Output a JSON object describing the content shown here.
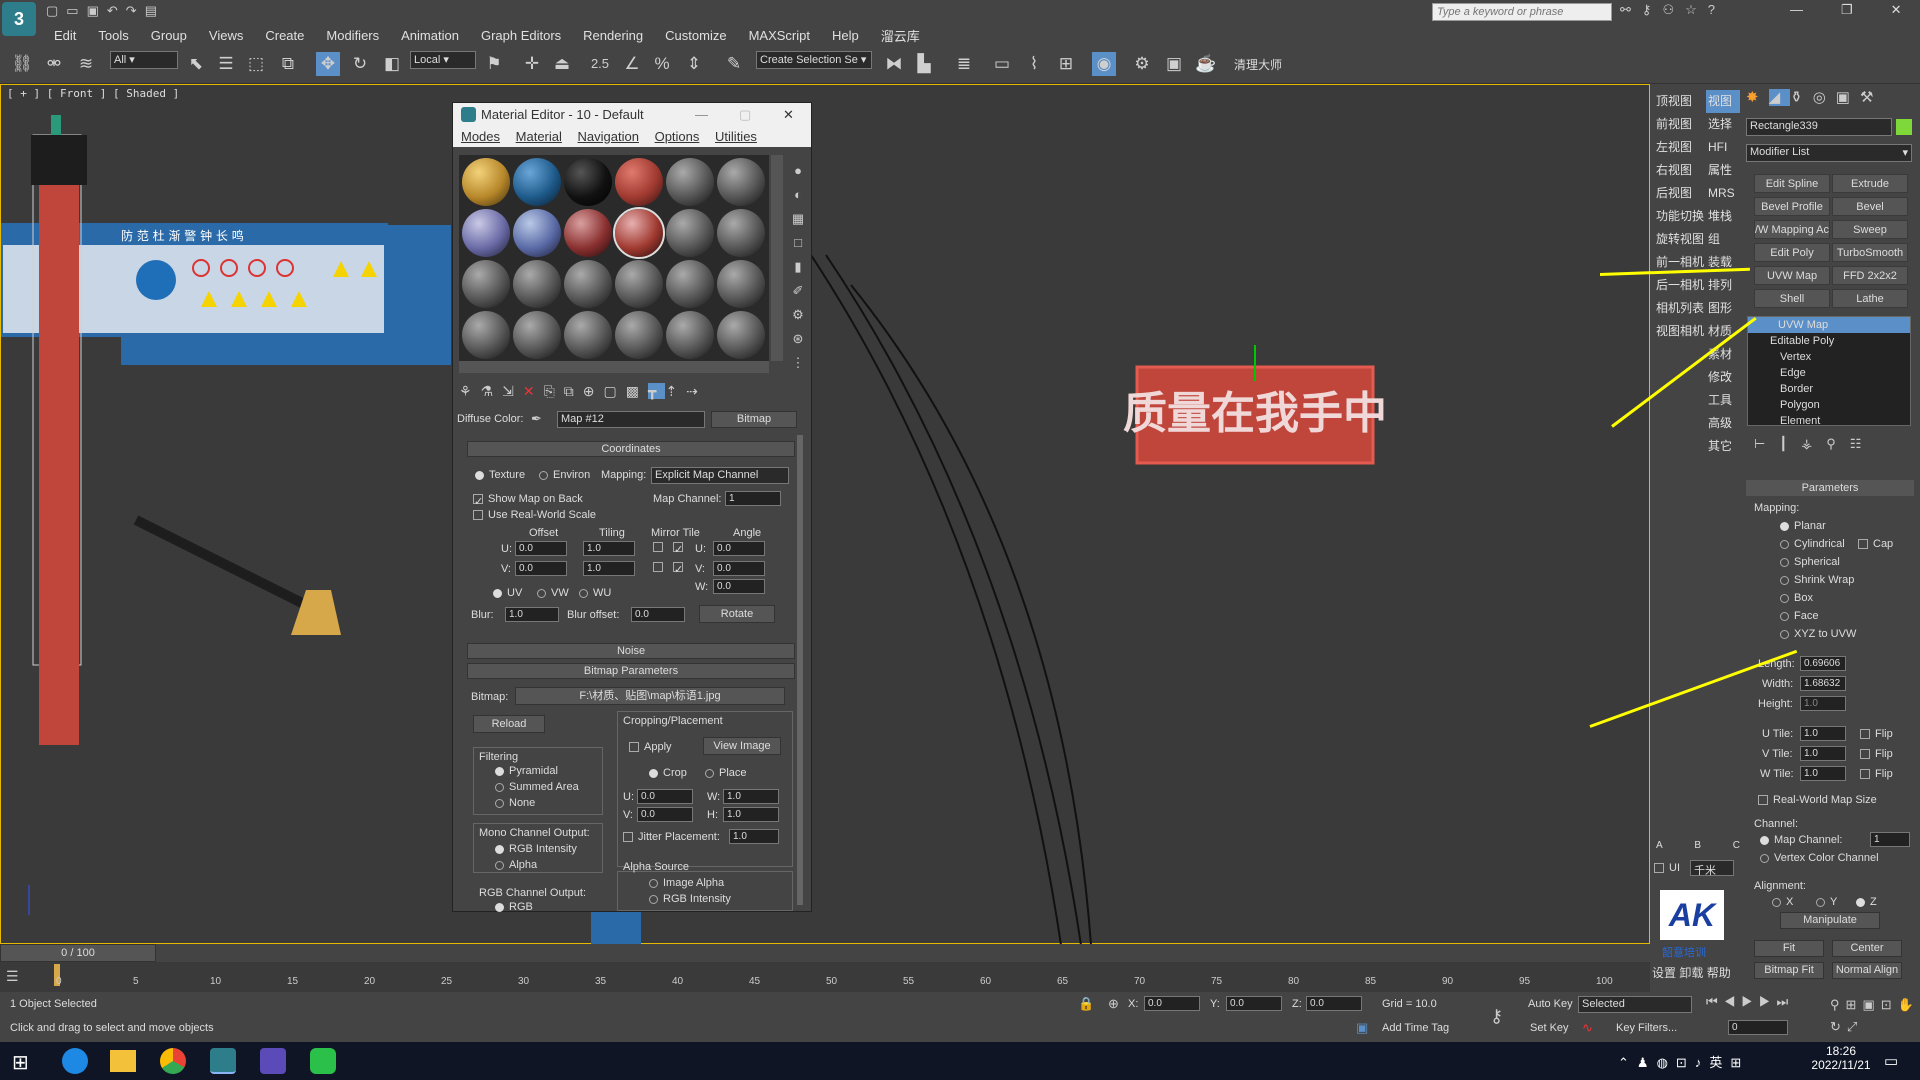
{
  "window": {
    "search_placeholder": "Type a keyword or phrase"
  },
  "menu": [
    "Edit",
    "Tools",
    "Group",
    "Views",
    "Create",
    "Modifiers",
    "Animation",
    "Graph Editors",
    "Rendering",
    "Customize",
    "MAXScript",
    "Help",
    "溜云库"
  ],
  "toolbar": {
    "filter": "All",
    "coord": "Local",
    "selection_set": "Create Selection Se",
    "snap_label": "2.5",
    "plugin_label": "清理大师"
  },
  "viewport": {
    "label": "[ + ] [ Front ] [ Shaded ]",
    "sign_text": "质量在我手中",
    "board_header": "防 范 杜 渐    警 钟 长 鸣"
  },
  "camera_nav": {
    "col1": [
      "顶视图",
      "前视图",
      "左视图",
      "右视图",
      "后视图",
      "功能切换",
      "旋转视图",
      "前一相机",
      "后一相机",
      "相机列表",
      "视图相机"
    ],
    "col2": [
      "视图",
      "选择",
      "HFI",
      "属性",
      "MRS",
      "堆栈",
      "组",
      "装载",
      "排列",
      "图形",
      "材质",
      "素材",
      "修改",
      "工具",
      "高级",
      "其它"
    ],
    "abc": [
      "A",
      "B",
      "C"
    ],
    "ui_label": "UI",
    "unit": "千米",
    "logo_caption": "韶意培训",
    "bottom": [
      "设置",
      "卸载",
      "帮助"
    ]
  },
  "cmd_panel": {
    "object_name": "Rectangle339",
    "color": "#7fd83a",
    "modifier_list": "Modifier List",
    "buttons": [
      "Edit Spline",
      "Extrude",
      "Bevel Profile",
      "Bevel",
      "/W Mapping Ac",
      "Sweep",
      "Edit Poly",
      "TurboSmooth",
      "UVW Map",
      "FFD 2x2x2",
      "Shell",
      "Lathe"
    ],
    "stack": [
      "UVW Map",
      "Editable Poly",
      "Vertex",
      "Edge",
      "Border",
      "Polygon",
      "Element"
    ],
    "params_title": "Parameters",
    "mapping_label": "Mapping:",
    "mapping_options": [
      "Planar",
      "Cylindrical",
      "Spherical",
      "Shrink Wrap",
      "Box",
      "Face",
      "XYZ to UVW"
    ],
    "cap": "Cap",
    "length_label": "Length:",
    "length": "0.69606",
    "width_label": "Width:",
    "width": "1.68632",
    "height_label": "Height:",
    "height": "1.0",
    "utile_label": "U Tile:",
    "utile": "1.0",
    "vtile_label": "V Tile:",
    "vtile": "1.0",
    "wtile_label": "W Tile:",
    "wtile": "1.0",
    "flip": "Flip",
    "realworld": "Real-World Map Size",
    "channel_label": "Channel:",
    "map_channel": "Map Channel:",
    "map_channel_val": "1",
    "vertex_color": "Vertex Color Channel",
    "alignment": "Alignment:",
    "ax": [
      "X",
      "Y",
      "Z"
    ],
    "manipulate": "Manipulate",
    "fit": "Fit",
    "center": "Center",
    "bitmap_fit": "Bitmap Fit",
    "normal_align": "Normal Align"
  },
  "material_editor": {
    "title": "Material Editor - 10 - Default",
    "menu": [
      "Modes",
      "Material",
      "Navigation",
      "Options",
      "Utilities"
    ],
    "diffuse_label": "Diffuse Color:",
    "map_name": "Map #12",
    "map_type": "Bitmap",
    "coords_title": "Coordinates",
    "texture": "Texture",
    "environ": "Environ",
    "mapping_label": "Mapping:",
    "mapping_val": "Explicit Map Channel",
    "show_map": "Show Map on Back",
    "map_channel_label": "Map Channel:",
    "map_channel_val": "1",
    "realworld": "Use Real-World Scale",
    "offset": "Offset",
    "tiling": "Tiling",
    "mirror_tile": "Mirror Tile",
    "angle": "Angle",
    "u": "U:",
    "v": "V:",
    "w": "W:",
    "u_off": "0.0",
    "v_off": "0.0",
    "u_tile": "1.0",
    "v_tile": "1.0",
    "u_ang": "0.0",
    "v_ang": "0.0",
    "w_ang": "0.0",
    "uv": "UV",
    "vw": "VW",
    "wu": "WU",
    "blur_label": "Blur:",
    "blur": "1.0",
    "blur_offset_label": "Blur offset:",
    "blur_offset": "0.0",
    "rotate": "Rotate",
    "noise": "Noise",
    "bitmap_params": "Bitmap Parameters",
    "bitmap_label": "Bitmap:",
    "bitmap_path": "F:\\材质、贴图\\map\\标语1.jpg",
    "reload": "Reload",
    "cropping": "Cropping/Placement",
    "apply": "Apply",
    "view_image": "View Image",
    "crop": "Crop",
    "place": "Place",
    "cu": "0.0",
    "cv": "0.0",
    "cw": "1.0",
    "ch": "1.0",
    "h": "H:",
    "jitter": "Jitter Placement:",
    "jitter_val": "1.0",
    "filtering": "Filtering",
    "pyramidal": "Pyramidal",
    "summed": "Summed Area",
    "none": "None",
    "mono": "Mono Channel Output:",
    "rgb_intensity": "RGB Intensity",
    "alpha": "Alpha",
    "alpha_source": "Alpha Source",
    "image_alpha": "Image Alpha",
    "rgb_intensity2": "RGB Intensity",
    "rgb_channel": "RGB Channel Output:",
    "rgb": "RGB"
  },
  "timeline": {
    "frame": "0 / 100",
    "ticks": [
      "0",
      "5",
      "10",
      "15",
      "20",
      "25",
      "30",
      "35",
      "40",
      "45",
      "50",
      "55",
      "60",
      "65",
      "70",
      "75",
      "80",
      "85",
      "90",
      "95",
      "100"
    ]
  },
  "status": {
    "selected": "1 Object Selected",
    "hint": "Click and drag to select and move objects",
    "x_label": "X:",
    "x": "0.0",
    "y_label": "Y:",
    "y": "0.0",
    "z_label": "Z:",
    "z": "0.0",
    "grid": "Grid = 10.0",
    "add_time_tag": "Add Time Tag",
    "auto_key": "Auto Key",
    "set_key": "Set Key",
    "selected_dd": "Selected",
    "key_filters": "Key Filters...",
    "frame_val": "0"
  },
  "taskbar": {
    "time": "18:26",
    "date": "2022/11/21",
    "ime": "英"
  }
}
